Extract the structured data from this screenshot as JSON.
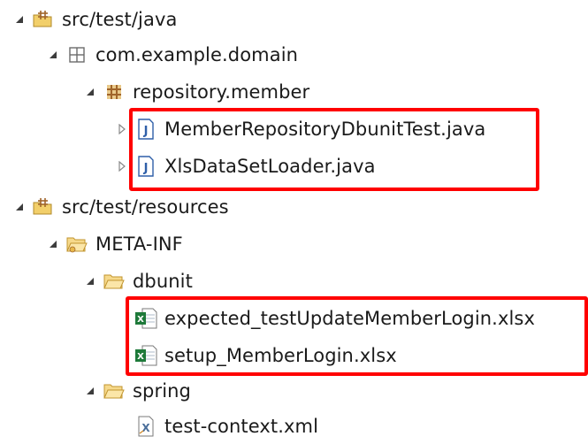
{
  "tree": {
    "items": [
      {
        "label": "src/test/java",
        "twisty": "expanded-arrow-icon",
        "icon": "source-folder-icon"
      },
      {
        "label": "com.example.domain",
        "twisty": "expanded-arrow-icon",
        "icon": "empty-package-icon"
      },
      {
        "label": "repository.member",
        "twisty": "expanded-arrow-icon",
        "icon": "package-icon"
      },
      {
        "label": "MemberRepositoryDbunitTest.java",
        "twisty": "collapsed-arrow-icon",
        "icon": "java-file-icon"
      },
      {
        "label": "XlsDataSetLoader.java",
        "twisty": "collapsed-arrow-icon",
        "icon": "java-file-icon"
      },
      {
        "label": "src/test/resources",
        "twisty": "expanded-arrow-icon",
        "icon": "source-folder-icon"
      },
      {
        "label": "META-INF",
        "twisty": "expanded-arrow-icon",
        "icon": "folder-icon"
      },
      {
        "label": "dbunit",
        "twisty": "expanded-arrow-icon",
        "icon": "folder-icon"
      },
      {
        "label": "expected_testUpdateMemberLogin.xlsx",
        "twisty": "",
        "icon": "excel-file-icon"
      },
      {
        "label": "setup_MemberLogin.xlsx",
        "twisty": "",
        "icon": "excel-file-icon"
      },
      {
        "label": "spring",
        "twisty": "expanded-arrow-icon",
        "icon": "folder-icon"
      },
      {
        "label": "test-context.xml",
        "twisty": "",
        "icon": "xml-file-icon"
      }
    ]
  },
  "colors": {
    "highlight": "#ff0000",
    "twisty": "#3c3c3c",
    "folder": "#e8b84a",
    "package": "#a0642a",
    "java": "#2f5fa8",
    "excel": "#1e7a3a"
  }
}
